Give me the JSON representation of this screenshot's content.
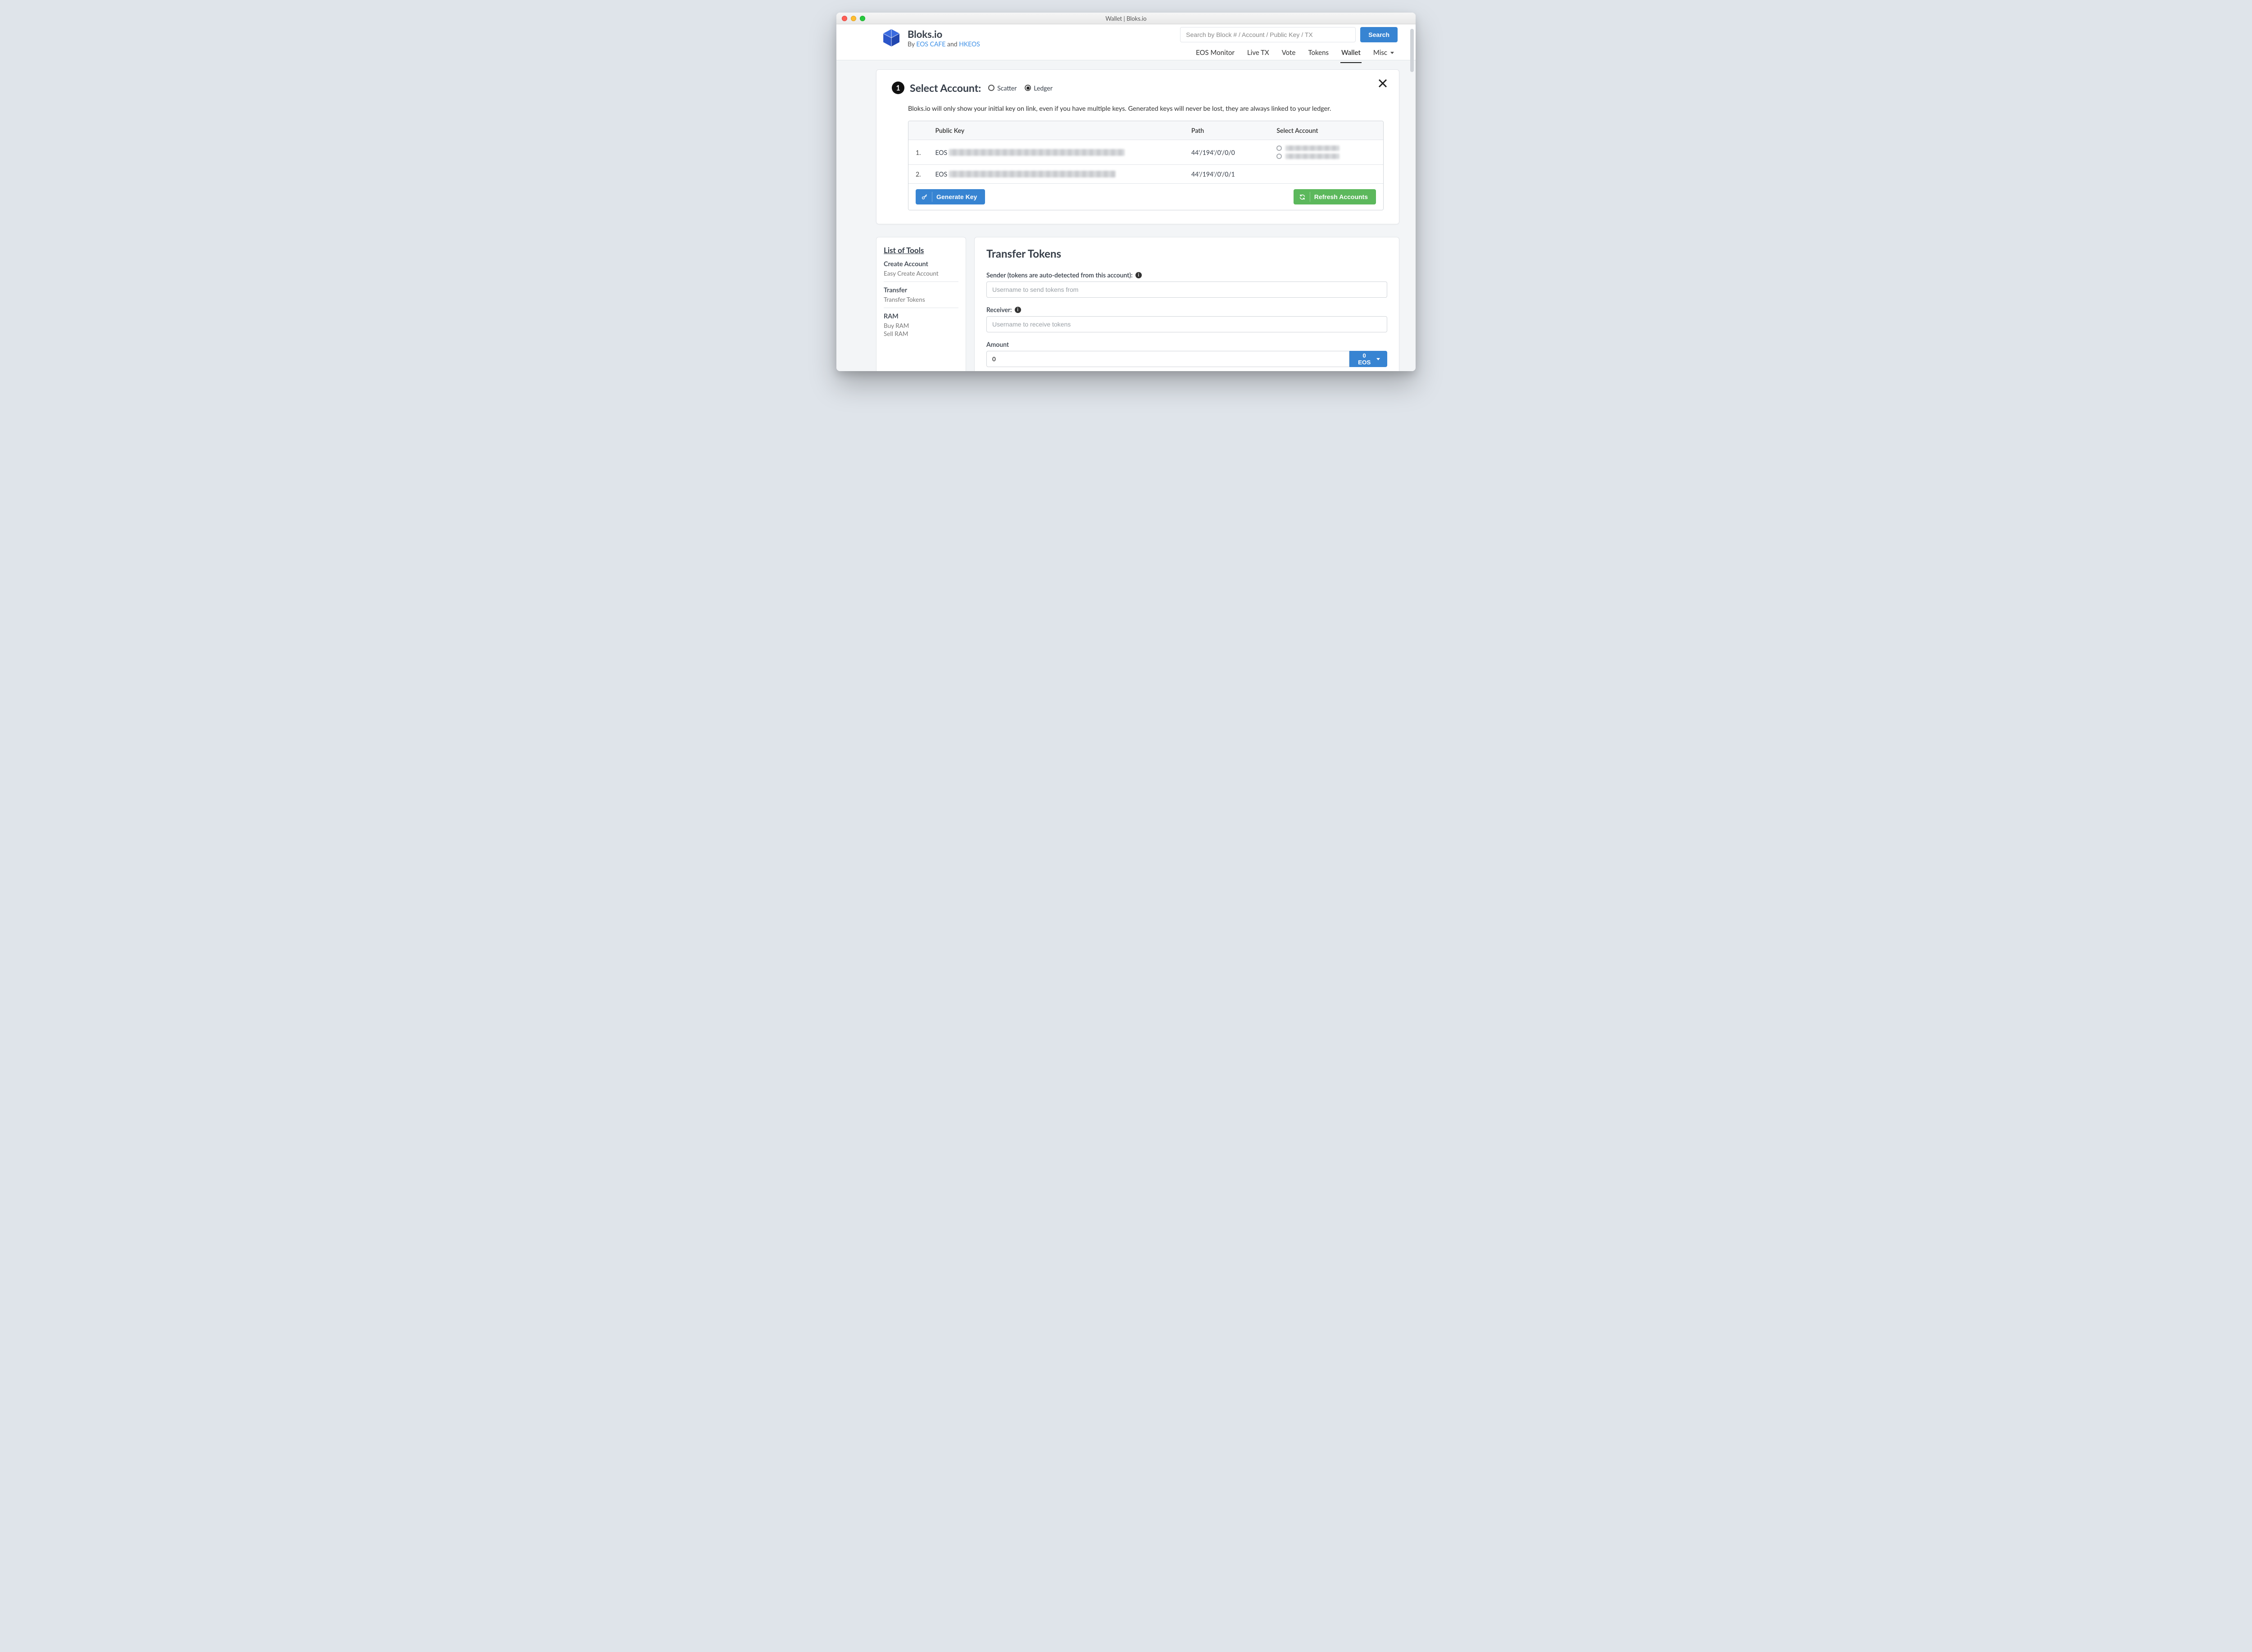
{
  "window": {
    "title": "Wallet | Bloks.io"
  },
  "brand": {
    "name": "Bloks.io",
    "byline_prefix": "By ",
    "byline_a": "EOS CAFE",
    "byline_and": " and ",
    "byline_b": "HKEOS"
  },
  "search": {
    "placeholder": "Search by Block # / Account / Public Key / TX",
    "button": "Search"
  },
  "nav": {
    "items": [
      "EOS Monitor",
      "Live TX",
      "Vote",
      "Tokens",
      "Wallet",
      "Misc"
    ],
    "active_index": 4
  },
  "step": {
    "number": "1",
    "title": "Select Account:",
    "options": [
      "Scatter",
      "Ledger"
    ],
    "selected_index": 1,
    "note": "Bloks.io will only show your initial key on link, even if you have multiple keys. Generated keys will never be lost, they are always linked to your ledger."
  },
  "key_table": {
    "headers": {
      "pk": "Public Key",
      "path": "Path",
      "select": "Select Account"
    },
    "rows": [
      {
        "idx": "1.",
        "prefix": "EOS",
        "path": "44'/194'/0'/0/0",
        "accounts": 2
      },
      {
        "idx": "2.",
        "prefix": "EOS",
        "path": "44'/194'/0'/0/1",
        "accounts": 0
      }
    ],
    "generate_btn": "Generate Key",
    "refresh_btn": "Refresh Accounts"
  },
  "tools": {
    "title": "List of Tools",
    "groups": [
      {
        "heading": "Create Account",
        "links": [
          "Easy Create Account"
        ]
      },
      {
        "heading": "Transfer",
        "links": [
          "Transfer Tokens"
        ]
      },
      {
        "heading": "RAM",
        "links": [
          "Buy RAM",
          "Sell RAM"
        ]
      }
    ]
  },
  "transfer": {
    "title": "Transfer Tokens",
    "sender_label": "Sender (tokens are auto-detected from this account):",
    "sender_placeholder": "Username to send tokens from",
    "receiver_label": "Receiver:",
    "receiver_placeholder": "Username to receive tokens",
    "amount_label": "Amount",
    "amount_value": "0",
    "unit_label": "0 EOS"
  }
}
